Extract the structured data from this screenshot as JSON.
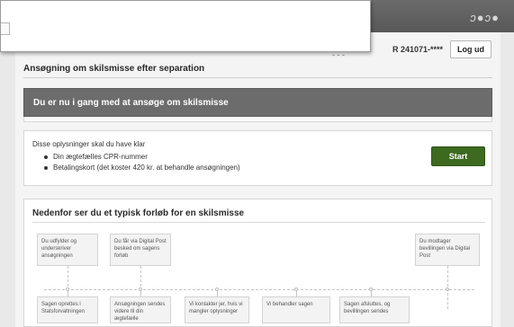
{
  "header": {
    "logo_text": "ɔ●ɔ●",
    "cpr_text": "R 241071-****",
    "logout_label": "Log ud",
    "dots_text": "- - -"
  },
  "page": {
    "title": "Ansøgning om skilsmisse efter separation",
    "banner": "Du er nu i gang med at ansøge om skilsmisse"
  },
  "info": {
    "lead": "Disse oplysninger skal du have klar",
    "items": [
      "Din ægtefælles CPR-nummer",
      "Betalingskort (det koster 420 kr. at behandle ansøgningen)"
    ],
    "start_label": "Start"
  },
  "flow": {
    "heading": "Nedenfor ser du et typisk forløb for en skilsmisse",
    "top_steps": [
      "Du udfylder og underskriver ansøgningen",
      "Du får via Digital Post besked om sagens forløb",
      "Du modtager bevillingen via Digital Post"
    ],
    "bottom_steps": [
      "Sagen oprettes i Statsforvaltningen",
      "Ansøgningen sendes videre til din ægtefælle",
      "Vi kontakter jer, hvis vi mangler oplysninger",
      "Vi behandler sagen",
      "Sagen afsluttes, og bevillingen sendes"
    ]
  },
  "colors": {
    "banner": "#6c6c6c",
    "start_button": "#3d6a1f",
    "topbar": "#606060"
  }
}
